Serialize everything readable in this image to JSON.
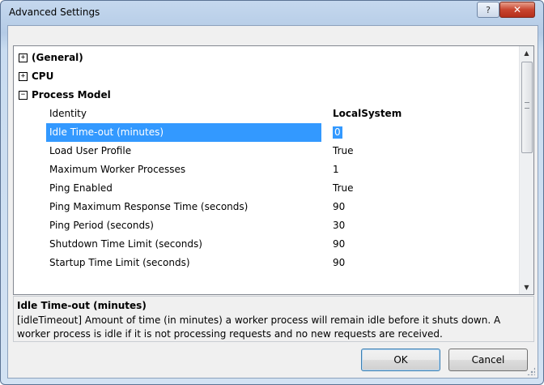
{
  "window": {
    "title": "Advanced Settings",
    "help_glyph": "?",
    "close_glyph": "✕"
  },
  "grid": {
    "categories": [
      {
        "toggle": "+",
        "label": "(General)"
      },
      {
        "toggle": "+",
        "label": "CPU"
      },
      {
        "toggle": "−",
        "label": "Process Model"
      }
    ],
    "properties": [
      {
        "name": "Identity",
        "value": "LocalSystem"
      },
      {
        "name": "Idle Time-out (minutes)",
        "value": "0"
      },
      {
        "name": "Load User Profile",
        "value": "True"
      },
      {
        "name": "Maximum Worker Processes",
        "value": "1"
      },
      {
        "name": "Ping Enabled",
        "value": "True"
      },
      {
        "name": "Ping Maximum Response Time (seconds)",
        "value": "90"
      },
      {
        "name": "Ping Period (seconds)",
        "value": "30"
      },
      {
        "name": "Shutdown Time Limit (seconds)",
        "value": "90"
      },
      {
        "name": "Startup Time Limit (seconds)",
        "value": "90"
      }
    ],
    "selected_property": "Idle Time-out (minutes)",
    "scroll_up": "▲",
    "scroll_down": "▼"
  },
  "description": {
    "title": "Idle Time-out (minutes)",
    "text": "[idleTimeout] Amount of time (in minutes) a worker process will remain idle before it shuts down. A worker process is idle if it is not processing requests and no new requests are received."
  },
  "buttons": {
    "ok": "OK",
    "cancel": "Cancel"
  }
}
